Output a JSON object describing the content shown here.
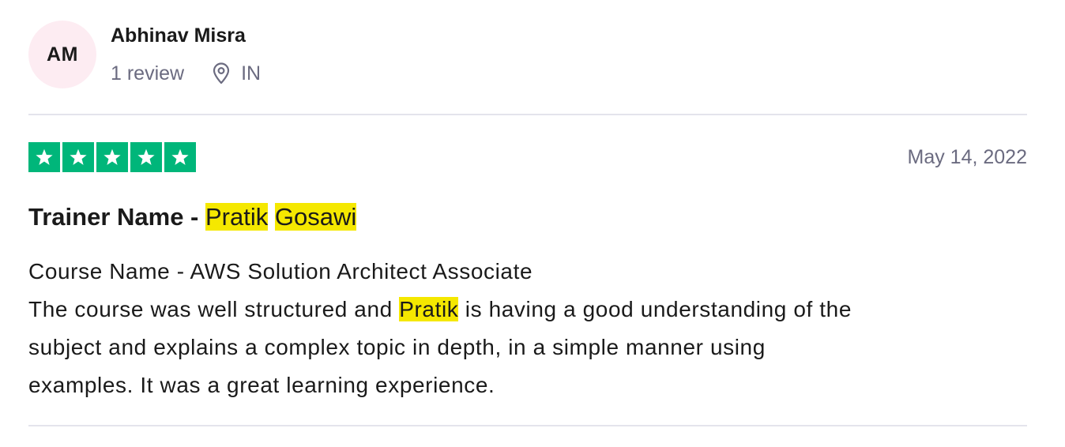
{
  "reviewer": {
    "initials": "AM",
    "name": "Abhinav Misra",
    "review_count": "1 review",
    "country": "IN",
    "location_icon": "map-pin-icon"
  },
  "rating": {
    "stars": 5,
    "max": 5,
    "color": "#00b67a"
  },
  "date": "May 14, 2022",
  "title": {
    "prefix": "Trainer Name - ",
    "highlight_1": "Pratik",
    "highlight_2": "Gosawi"
  },
  "body": {
    "line_1": "Course Name - AWS Solution Architect Associate",
    "line_2_before": "The course was well structured and ",
    "line_2_highlight": "Pratik",
    "line_2_after": " is having a good understanding of the",
    "line_3": "subject and explains a complex topic in depth, in a simple manner using",
    "line_4": "examples. It was a great learning experience."
  },
  "colors": {
    "highlight": "#f5e800",
    "avatar_bg": "#fdecf2",
    "muted_text": "#6b6b80"
  }
}
